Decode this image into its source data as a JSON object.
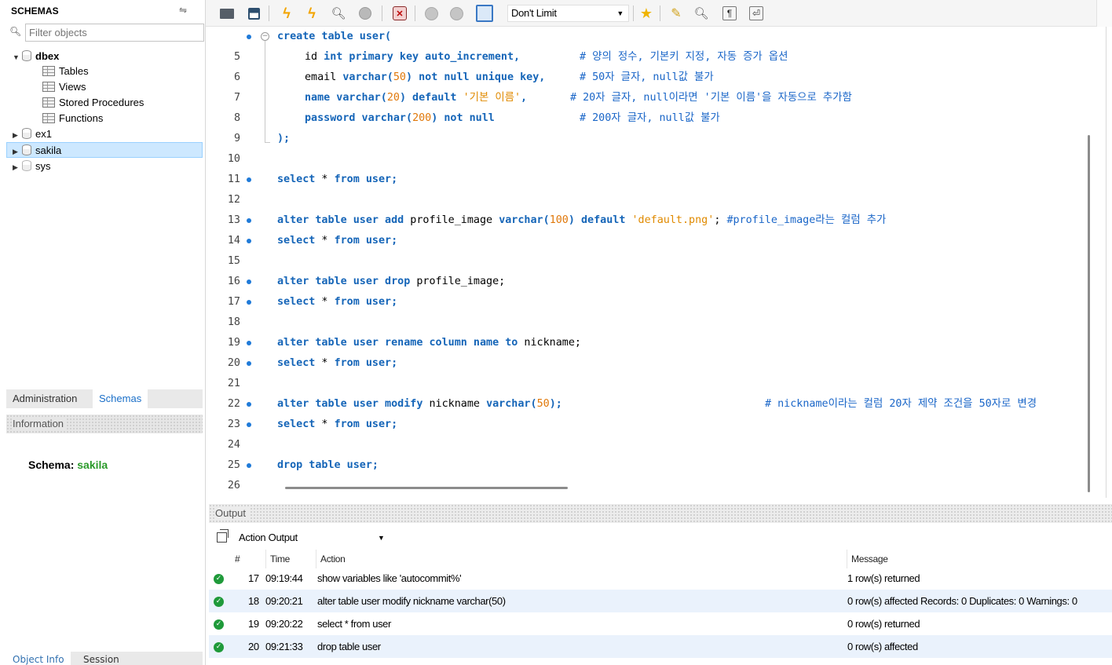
{
  "sidebar": {
    "title": "SCHEMAS",
    "filter_placeholder": "Filter objects",
    "tree": {
      "dbex": "dbex",
      "tables": "Tables",
      "views": "Views",
      "procedures": "Stored Procedures",
      "functions": "Functions",
      "ex1": "ex1",
      "sakila": "sakila",
      "sys": "sys"
    },
    "tabs": {
      "administration": "Administration",
      "schemas": "Schemas"
    },
    "info_title": "Information",
    "schema_label": "Schema: ",
    "schema_value": "sakila",
    "bottom_tabs": {
      "object_info": "Object Info",
      "session": "Session"
    }
  },
  "toolbar": {
    "limit_value": "Don't Limit"
  },
  "editor": {
    "lines": {
      "l5": "5",
      "l6": "6",
      "l7": "7",
      "l8": "8",
      "l9": "9",
      "l10": "10",
      "l11": "11",
      "l12": "12",
      "l13": "13",
      "l14": "14",
      "l15": "15",
      "l16": "16",
      "l17": "17",
      "l18": "18",
      "l19": "19",
      "l20": "20",
      "l21": "21",
      "l22": "22",
      "l23": "23",
      "l24": "24",
      "l25": "25",
      "l26": "26"
    },
    "code": {
      "c5": [
        "create table user("
      ],
      "c6_kw1": "id",
      "c6_kw2": " int primary key auto_increment,",
      "c6_cm": "# 양의 정수, 기본키 지정, 자동 증가 옵션",
      "c7_id": "email",
      "c7_kw": " varchar(",
      "c7_num": "50",
      "c7_kw2": ") not null unique key,",
      "c7_cm": "# 50자 글자, null값 불가",
      "c8_kw": "name varchar(",
      "c8_num": "20",
      "c8_kw2": ") default ",
      "c8_str": "'기본 이름'",
      "c8_p": ",",
      "c8_cm": "# 20자 글자, null이라면 '기본 이름'을 자동으로 추가함",
      "c9_kw": "password varchar(",
      "c9_num": "200",
      "c9_kw2": ") not null",
      "c9_cm": "# 200자 글자, null값 불가",
      "c10": ");",
      "select_kw1": "select",
      "select_id": " * ",
      "select_kw2": "from",
      "select_tbl": " user;",
      "c14_kw": "alter table user add",
      "c14_id": " profile_image ",
      "c14_kw2": "varchar(",
      "c14_num": "100",
      "c14_kw3": ") default ",
      "c14_str": "'default.png'",
      "c14_p": "; ",
      "c14_cm": "#profile_image라는 컬럼 추가",
      "c17_kw": "alter table user drop",
      "c17_id": " profile_image;",
      "c20_kw": "alter table user rename column name to",
      "c20_id": " nickname;",
      "c23_kw": "alter table user modify",
      "c23_id": " nickname ",
      "c23_kw2": "varchar(",
      "c23_num": "50",
      "c23_kw3": ");",
      "c23_cm": "# nickname이라는 컬럼 20자 제약 조건을 50자로 변경",
      "c26_kw": "drop table user;"
    }
  },
  "output": {
    "title": "Output",
    "selector": "Action Output",
    "columns": {
      "num": "#",
      "time": "Time",
      "action": "Action",
      "message": "Message"
    },
    "rows": [
      {
        "num": "17",
        "time": "09:19:44",
        "action": "show variables like 'autocommit%'",
        "message": "1 row(s) returned"
      },
      {
        "num": "18",
        "time": "09:20:21",
        "action": "alter table user modify nickname varchar(50)",
        "message": "0 row(s) affected Records: 0  Duplicates: 0  Warnings: 0"
      },
      {
        "num": "19",
        "time": "09:20:22",
        "action": "select * from user",
        "message": "0 row(s) returned"
      },
      {
        "num": "20",
        "time": "09:21:33",
        "action": "drop table user",
        "message": "0 row(s) affected"
      }
    ]
  }
}
